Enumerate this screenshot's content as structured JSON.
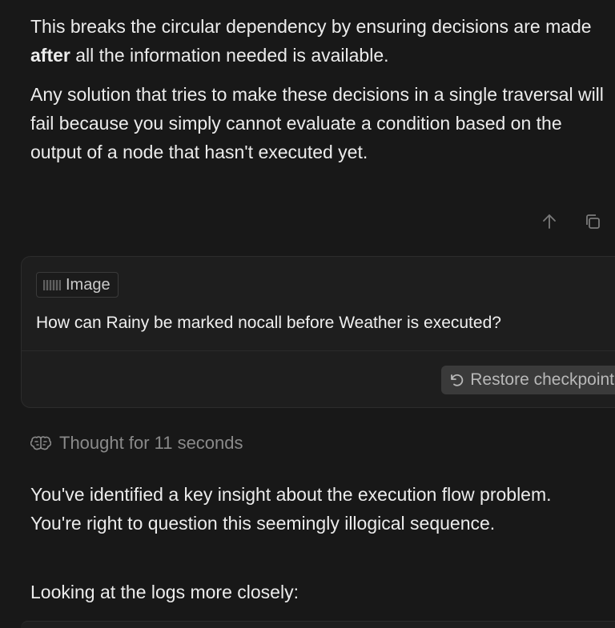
{
  "chat": {
    "p1_pre": "This breaks the circular dependency by ensuring decisions are made ",
    "p1_bold": "after",
    "p1_post": " all the information needed is available.",
    "p2": "Any solution that tries to make these decisions in a single traversal will fail because you simply cannot evaluate a condition based on the output of a node that hasn't executed yet.",
    "actions": {
      "up_icon": "arrow-up-icon",
      "copy_icon": "copy-icon"
    }
  },
  "user_message": {
    "attachment_label": "Image",
    "question": "How can Rainy be marked nocall before Weather is executed?",
    "restore_label": "Restore checkpoint"
  },
  "reply": {
    "thought_label": "Thought for 11 seconds",
    "p3": "You've identified a key insight about the execution flow problem. You're right to question this seemingly illogical sequence.",
    "p4": "Looking at the logs more closely:"
  },
  "colors": {
    "background": "#181818",
    "card": "#1e1e1e",
    "text": "#ececec",
    "muted": "#8a8a8a",
    "button": "#3a3a3a"
  }
}
